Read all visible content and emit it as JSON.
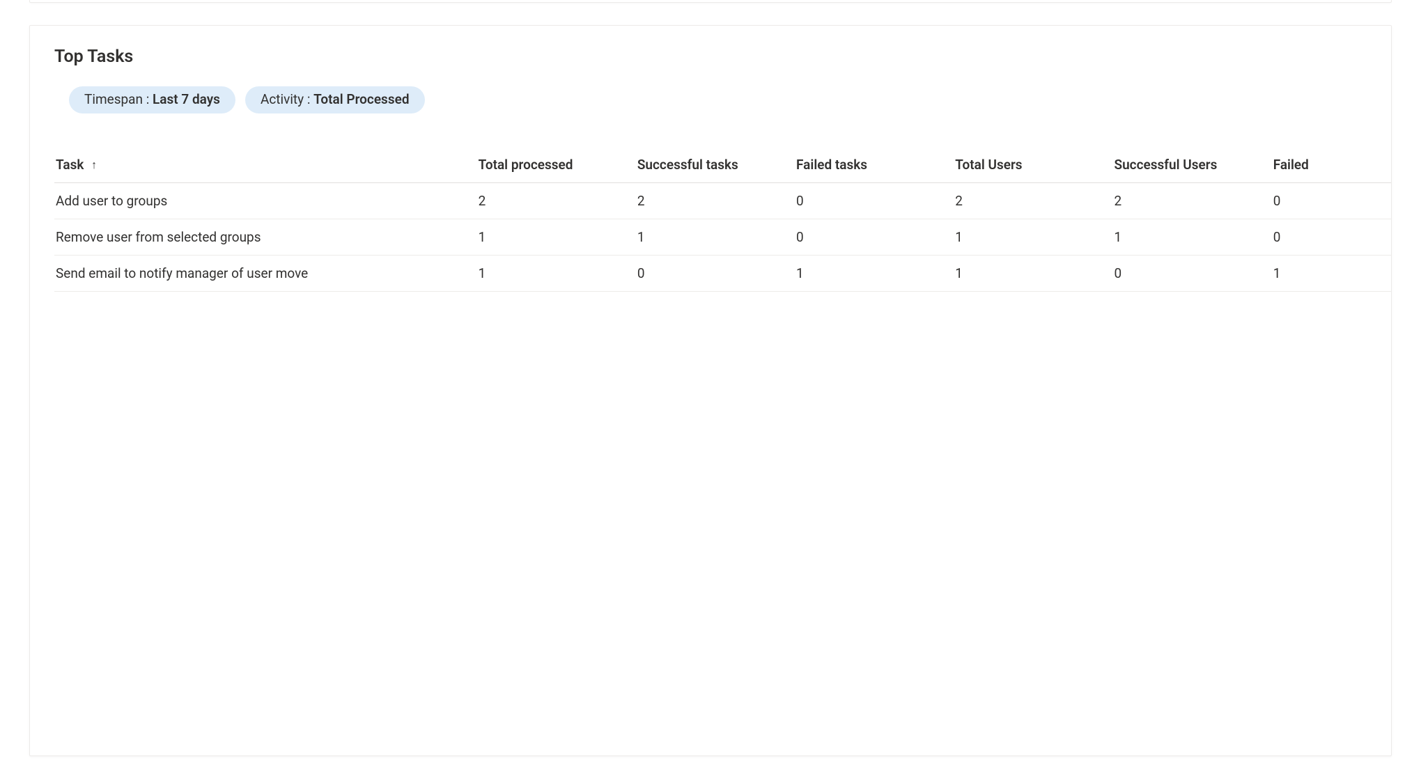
{
  "card": {
    "title": "Top Tasks"
  },
  "filters": {
    "timespan": {
      "label": "Timespan : ",
      "value": "Last 7 days"
    },
    "activity": {
      "label": "Activity : ",
      "value": "Total Processed"
    }
  },
  "table": {
    "sort_arrow": "↑",
    "columns": {
      "task": "Task",
      "total_processed": "Total processed",
      "successful_tasks": "Successful tasks",
      "failed_tasks": "Failed tasks",
      "total_users": "Total Users",
      "successful_users": "Successful Users",
      "failed": "Failed"
    },
    "rows": [
      {
        "task": "Add user to groups",
        "total_processed": "2",
        "successful_tasks": "2",
        "failed_tasks": "0",
        "total_users": "2",
        "successful_users": "2",
        "failed": "0"
      },
      {
        "task": "Remove user from selected groups",
        "total_processed": "1",
        "successful_tasks": "1",
        "failed_tasks": "0",
        "total_users": "1",
        "successful_users": "1",
        "failed": "0"
      },
      {
        "task": "Send email to notify manager of user move",
        "total_processed": "1",
        "successful_tasks": "0",
        "failed_tasks": "1",
        "total_users": "1",
        "successful_users": "0",
        "failed": "1"
      }
    ]
  }
}
